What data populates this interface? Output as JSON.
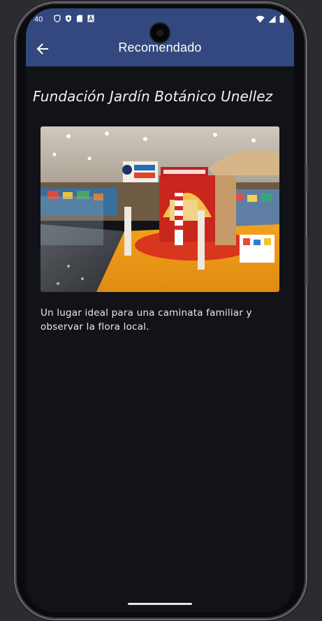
{
  "status_bar": {
    "time": "40",
    "left_icons": [
      "shield-icon",
      "vpn-icon",
      "sd-card-icon",
      "font-a-icon"
    ],
    "right_icons": [
      "wifi-icon",
      "signal-icon",
      "battery-icon"
    ]
  },
  "app_bar": {
    "back_icon": "arrow-left-icon",
    "title": "Recomendado"
  },
  "place": {
    "title": "Fundación Jardín Botánico Unellez",
    "image_alt": "store-photo",
    "description": "Un lugar ideal para una caminata familiar y observar la flora local."
  },
  "colors": {
    "app_bar": "#33487e",
    "background": "#111318",
    "text": "#e9e9ee"
  }
}
